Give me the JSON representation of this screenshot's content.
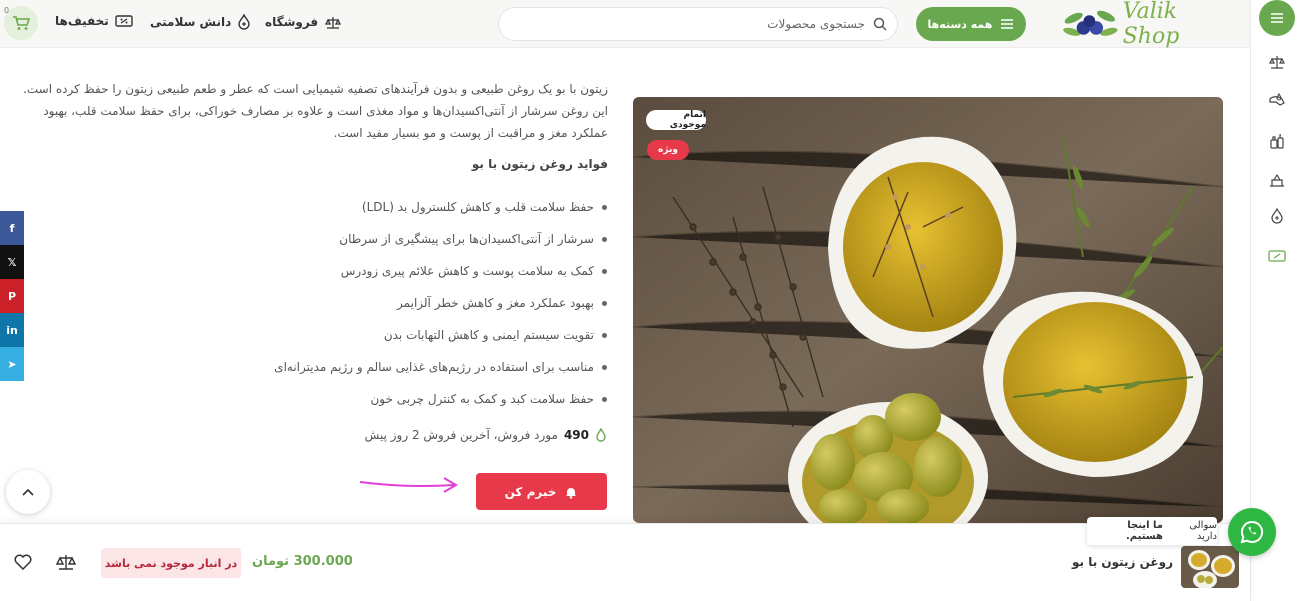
{
  "header": {
    "cart_count": "0",
    "nav": [
      {
        "label": "تخفیف‌ها",
        "icon": "discount-ticket-icon"
      },
      {
        "label": "دانش سلامتی",
        "icon": "health-drop-icon"
      },
      {
        "label": "فروشگاه",
        "icon": "shop-scale-icon"
      }
    ],
    "search_placeholder": "جستجوی محصولات",
    "categories_label": "همه دسته‌ها",
    "logo_text": "Valik Shop"
  },
  "product": {
    "description": "زیتون با بو یک روغن طبیعی و بدون فرآیندهای تصفیه شیمیایی است که عطر و طعم طبیعی زیتون را حفظ کرده است. این روغن سرشار از آنتی‌اکسیدان‌ها و مواد مغذی است و علاوه بر مصارف خوراکی، برای حفظ سلامت قلب، بهبود عملکرد مغز و مراقبت از پوست و مو بسیار مفید است.",
    "benefits_title": "فواید روغن زیتون با بو",
    "benefits": [
      "حفظ سلامت قلب و کاهش کلسترول بد (LDL)",
      "سرشار از آنتی‌اکسیدان‌ها برای پیشگیری از سرطان",
      "کمک به سلامت پوست و کاهش علائم پیری زودرس",
      "بهبود عملکرد مغز و کاهش خطر آلزایمر",
      "تقویت سیستم ایمنی و کاهش التهابات بدن",
      "مناسب برای استفاده در رژیم‌های غذایی سالم و رژیم مدیترانه‌ای",
      "حفظ سلامت کبد و کمک به کنترل چربی خون"
    ],
    "sales_count": "490",
    "sales_text": "مورد فروش، آخرین فروش 2 روز پیش",
    "notify_label": "خبرم کن",
    "badge_out_of_stock": "اتمام موجودی",
    "badge_special": "ویژه"
  },
  "sticky": {
    "name": "روغن زیتون با بو",
    "price": "300.000 تومان",
    "stock_status": "در انبار موجود نمی باشد"
  },
  "whatsapp": {
    "tooltip_prefix": "سوالی دارید",
    "tooltip_bold": "ما اینجا هستیم."
  },
  "social": [
    {
      "icon": "facebook-icon",
      "glyph": "f",
      "color": "#3b5998"
    },
    {
      "icon": "x-icon",
      "glyph": "𝕏",
      "color": "#111111"
    },
    {
      "icon": "pinterest-icon",
      "glyph": "P",
      "color": "#cb2027"
    },
    {
      "icon": "linkedin-icon",
      "glyph": "in",
      "color": "#0e76a8"
    },
    {
      "icon": "telegram-icon",
      "glyph": "➤",
      "color": "#37aee2"
    }
  ],
  "colors": {
    "accent": "#6aa84f",
    "danger": "#e8394a",
    "whatsapp": "#2fb744"
  }
}
